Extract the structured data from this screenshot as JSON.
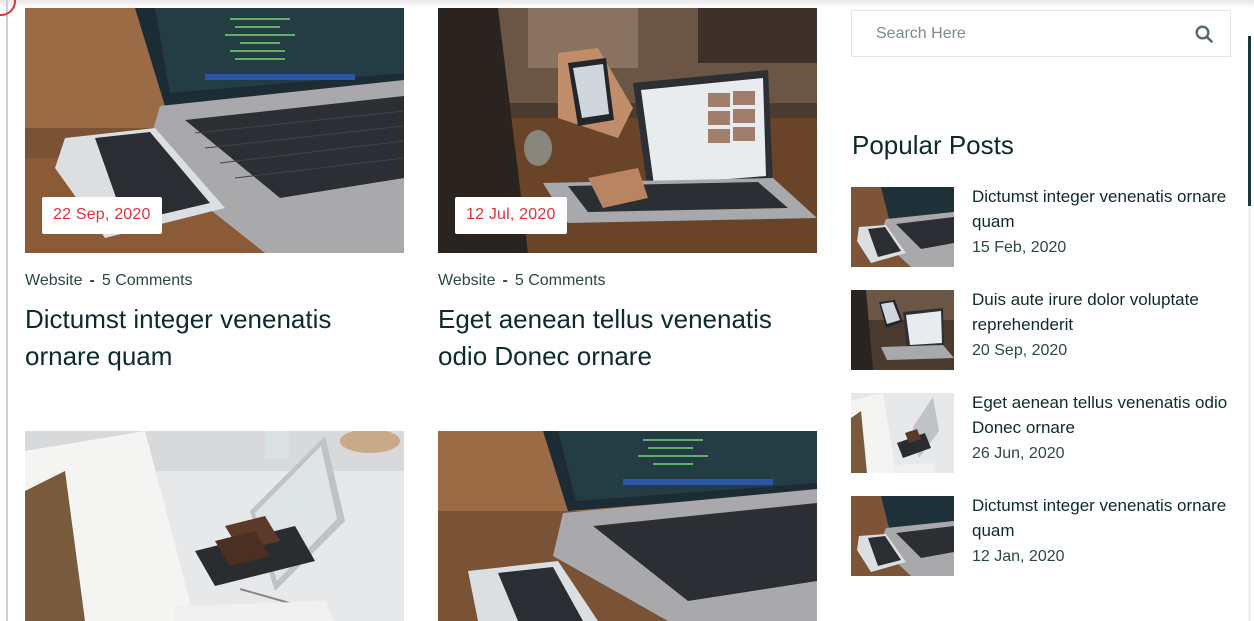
{
  "posts": [
    {
      "date": "22 Sep, 2020",
      "category": "Website",
      "separator": "-",
      "comments": "5 Comments",
      "title": "Dictumst integer venenatis ornare quam"
    },
    {
      "date": "12 Jul, 2020",
      "category": "Website",
      "separator": "-",
      "comments": "5 Comments",
      "title": "Eget aenean tellus venenatis odio Donec ornare"
    }
  ],
  "search": {
    "placeholder": "Search Here"
  },
  "sidebar": {
    "popular_title": "Popular Posts",
    "items": [
      {
        "title": "Dictumst integer venenatis ornare quam",
        "date": "15 Feb, 2020"
      },
      {
        "title": "Duis aute irure dolor voluptate reprehenderit",
        "date": "20 Sep, 2020"
      },
      {
        "title": "Eget aenean tellus venenatis odio Donec ornare",
        "date": "26 Jun, 2020"
      },
      {
        "title": "Dictumst integer venenatis ornare quam",
        "date": "12 Jan, 2020"
      }
    ]
  },
  "colors": {
    "accent": "#e0323b",
    "heading": "#0e2a2c",
    "text": "#2f4546"
  },
  "icons": {
    "search": "search-icon"
  }
}
